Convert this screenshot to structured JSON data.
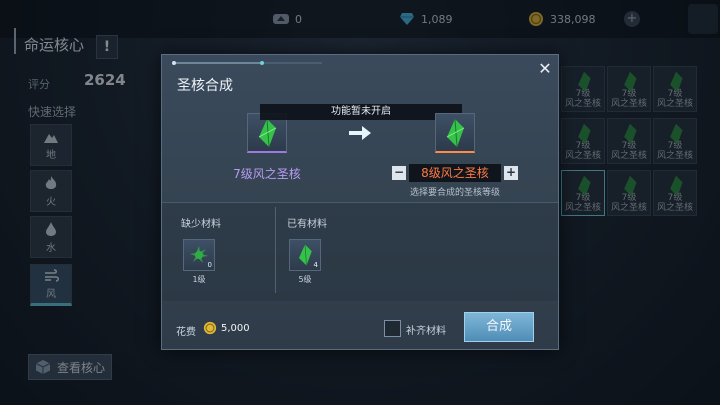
{
  "topbar": {
    "res_a_value": "0",
    "res_b_value": "1,089",
    "res_c_value": "338,098",
    "plus_icon": "plus-icon"
  },
  "left": {
    "title": "命运核心",
    "alert_icon": "!",
    "score_label": "评分",
    "score_value": "2624",
    "quick_select_label": "快速选择",
    "elements": [
      {
        "label": "地",
        "icon": "earth-icon"
      },
      {
        "label": "火",
        "icon": "fire-icon"
      },
      {
        "label": "水",
        "icon": "water-icon"
      },
      {
        "label": "风",
        "icon": "wind-icon",
        "active": true
      }
    ],
    "view_core_label": "查看核心"
  },
  "grid": {
    "items": [
      {
        "level": "7级",
        "name": "风之圣核"
      },
      {
        "level": "7级",
        "name": "风之圣核"
      },
      {
        "level": "7级",
        "name": "风之圣核"
      },
      {
        "level": "7级",
        "name": "风之圣核"
      },
      {
        "level": "7级",
        "name": "风之圣核"
      },
      {
        "level": "7级",
        "name": "风之圣核"
      },
      {
        "level": "7级",
        "name": "风之圣核"
      },
      {
        "level": "7级",
        "name": "风之圣核"
      },
      {
        "level": "7级",
        "name": "风之圣核"
      }
    ]
  },
  "modal": {
    "title": "圣核合成",
    "notice": "功能暂未开启",
    "source_name": "7级风之圣核",
    "target_name": "8级风之圣核",
    "target_hint": "选择要合成的圣核等级",
    "missing_label": "缺少材料",
    "owned_label": "已有材料",
    "missing_material": {
      "count": "0",
      "level": "1级"
    },
    "owned_material": {
      "count": "4",
      "level": "5级"
    },
    "cost_label": "花费",
    "cost_value": "5,000",
    "auto_fill_label": "补齐材料",
    "craft_button": "合成",
    "minus": "−",
    "plus": "+",
    "close": "✕"
  },
  "colors": {
    "source_name": "#b79cf2",
    "target_name": "#ff7a45",
    "craft_button": "#5a98c0",
    "gem_green": "#35c24a"
  }
}
